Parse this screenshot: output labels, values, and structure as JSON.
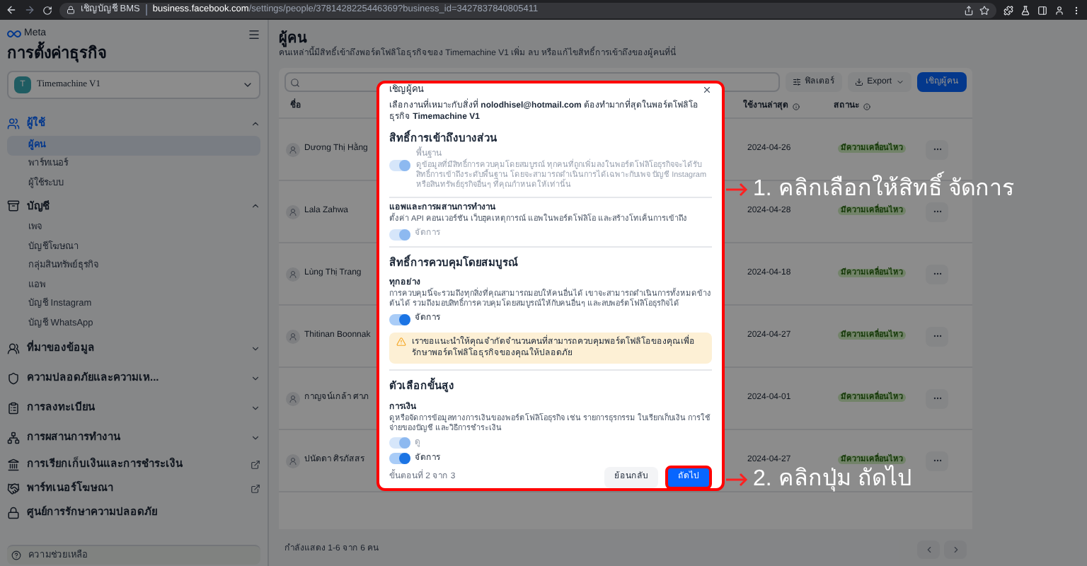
{
  "browser": {
    "page_title": "เชิญบัญชี BMS",
    "url_host": "business.facebook.com",
    "url_path": "/settings/people/3781428225446369?business_id=3427837840805411"
  },
  "sidebar": {
    "brand": "Meta",
    "title": "การตั้งค่าธุรกิจ",
    "account": {
      "initial": "T",
      "name": "Timemachine V1"
    },
    "sections": [
      {
        "label": "ผู้ใช้",
        "expanded": true,
        "selected": true,
        "children": [
          {
            "label": "ผู้คน",
            "selected": true
          },
          {
            "label": "พาร์ทเนอร์",
            "selected": false
          },
          {
            "label": "ผู้ใช้ระบบ",
            "selected": false
          }
        ]
      },
      {
        "label": "บัญชี",
        "expanded": true,
        "selected": false,
        "children": [
          {
            "label": "เพจ",
            "selected": false
          },
          {
            "label": "บัญชีโฆษณา",
            "selected": false
          },
          {
            "label": "กลุ่มสินทรัพย์ธุรกิจ",
            "selected": false
          },
          {
            "label": "แอพ",
            "selected": false
          },
          {
            "label": "บัญชี Instagram",
            "selected": false
          },
          {
            "label": "บัญชี WhatsApp",
            "selected": false
          }
        ]
      },
      {
        "label": "ที่มาของข้อมูล",
        "expanded": false,
        "selected": false
      },
      {
        "label": "ความปลอดภัยและความเห...",
        "expanded": false,
        "selected": false
      },
      {
        "label": "การลงทะเบียน",
        "expanded": false,
        "selected": false
      },
      {
        "label": "การผสานการทำงาน",
        "expanded": false,
        "selected": false
      }
    ],
    "links": [
      {
        "label": "การเรียกเก็บเงินและการชำระเงิน",
        "external": true
      },
      {
        "label": "พาร์ทเนอร์โฆษณา",
        "external": true
      },
      {
        "label": "ศูนย์การรักษาความปลอดภัย",
        "external": false
      }
    ],
    "help": "ความช่วยเหลือ"
  },
  "main": {
    "title": "ผู้คน",
    "subtitle": "คนเหล่านี้มีสิทธิ์เข้าถึงพอร์ตโฟลิโอธุรกิจของ Timemachine V1 เพิ่ม ลบ หรือแก้ไขสิทธิ์การเข้าถึงของผู้คนที่นี่",
    "toolbar": {
      "filter": "ฟิลเตอร์",
      "export": "Export",
      "invite": "เชิญผู้คน"
    },
    "table": {
      "columns": [
        "ชื่อ",
        "ใช้งานล่าสุด",
        "สถานะ"
      ],
      "rows": [
        {
          "name": "Dương Thị Hằng",
          "last_active": "2024-04-26",
          "status": "มีความเคลื่อนไหว"
        },
        {
          "name": "Lala Zahwa",
          "last_active": "2024-04-28",
          "status": "มีความเคลื่อนไหว"
        },
        {
          "name": "Lùng Thị Trang",
          "last_active": "2024-04-18",
          "status": "มีความเคลื่อนไหว"
        },
        {
          "name": "Thitinan Boonnak",
          "last_active": "2024-04-27",
          "status": "มีความเคลื่อนไหว"
        },
        {
          "name": "กาญจน์เกล้า ศาภ",
          "last_active": "2024-04-01",
          "status": "มีความเคลื่อนไหว"
        },
        {
          "name": "ปนัดดา ศิรภัสสร",
          "last_active": "2024-04-27",
          "status": "มีความเคลื่อนไหว"
        }
      ]
    },
    "footer": "กำลังแสดง 1-6 จาก 6 คน"
  },
  "modal": {
    "title": "เชิญผู้คน",
    "intro": "เลือกงานที่เหมาะกับสิ่งที่ **nolodhisel@hotmail.com** ต้องทำมากที่สุดในพอร์ตโฟลิโอธุรกิจ **Timemachine V1**",
    "sections": [
      {
        "title": "สิทธิ์การเข้าถึงบางส่วน",
        "items": [
          {
            "kind": "inline",
            "title": "พื้นฐาน",
            "description": "ดูข้อมูลที่มีสิทธิ์การควบคุมโดยสมบูรณ์ ทุกคนที่ถูกเพิ่มลงในพอร์ตโฟลิโอธุรกิจจะได้รับสิทธิ์การเข้าถึงระดับพื้นฐาน โดยจะสามารถดำเนินการได้เฉพาะกับเพจ บัญชี Instagram หรือสินทรัพย์ธุรกิจอื่นๆ ที่คุณกำหนดให้เท่านั้น",
            "toggles": [
              {
                "checked": true,
                "disabled": true
              }
            ]
          },
          {
            "kind": "stacked",
            "title": "แอพและการผสานการทำงาน",
            "description": "ตั้งค่า API คอนเวอร์ชัน เว็บฮุคเหตุการณ์ แอพในพอร์ตโฟลิโอ และสร้างโทเค็นการเข้าถึง",
            "toggles": [
              {
                "label": "จัดการ",
                "checked": true,
                "disabled": true
              }
            ]
          }
        ]
      },
      {
        "title": "สิทธิ์การควบคุมโดยสมบูรณ์",
        "items": [
          {
            "kind": "stacked",
            "title": "ทุกอย่าง",
            "description": "การควบคุมนี้จะรวมถึงทุกสิ่งที่คุณสามารถมอบให้คนอื่นได้ เขาจะสามารถดำเนินการทั้งหมดข้างต้นได้ รวมถึงมอบสิทธิ์การควบคุมโดยสมบูรณ์ให้กับคนอื่นๆ และลบพอร์ตโฟลิโอธุรกิจได้",
            "toggles": [
              {
                "label": "จัดการ",
                "checked": true,
                "disabled": false
              }
            ]
          }
        ],
        "warning": "เราขอแนะนำให้คุณจำกัดจำนวนคนที่สามารถควบคุมพอร์ตโฟลิโอของคุณเพื่อรักษาพอร์ตโฟลิโอธุรกิจของคุณให้ปลอดภัย"
      },
      {
        "title": "ตัวเลือกขั้นสูง",
        "items": [
          {
            "kind": "stacked",
            "title": "การเงิน",
            "description": "ดูหรือจัดการข้อมูลทางการเงินของพอร์ตโฟลิโอธุรกิจ เช่น รายการธุรกรรม ใบเรียกเก็บเงิน การใช้จ่ายของบัญชี และวิธีการชำระเงิน",
            "toggles": [
              {
                "label": "ดู",
                "checked": true,
                "disabled": true
              },
              {
                "label": "จัดการ",
                "checked": true,
                "disabled": false
              }
            ]
          }
        ]
      }
    ],
    "step": "ขั้นตอนที่ 2 จาก 3",
    "back": "ย้อนกลับ",
    "next": "ถัดไป"
  },
  "annotations": [
    {
      "text": "1. คลิกเลือกให้สิทธิ์ จัดการ"
    },
    {
      "text": "2. คลิกปุ่ม ถัดไป"
    }
  ]
}
